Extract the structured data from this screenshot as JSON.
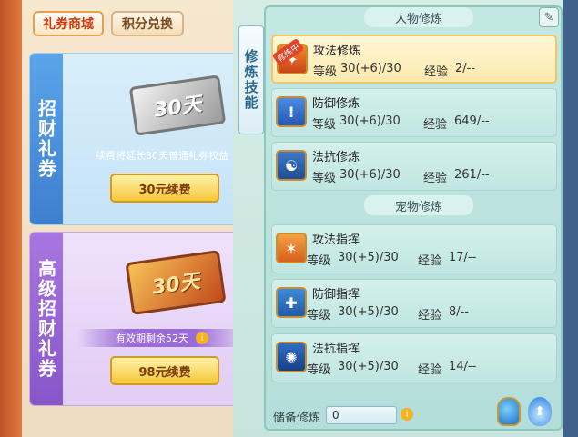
{
  "tabs": [
    {
      "label": "礼券商城",
      "active": true
    },
    {
      "label": "积分兑换",
      "active": false
    }
  ],
  "coupon_cards": [
    {
      "side_title": "招财礼券",
      "ticket_text": "30天",
      "note": "续费将延长30天普通礼券权益",
      "button": "30元续费"
    },
    {
      "side_title": "高级招财礼券",
      "ticket_text": "30天",
      "note": "有效期剩余52天",
      "button": "98元续费"
    }
  ],
  "vertical_tab": "修炼技能",
  "sections": {
    "character": "人物修炼",
    "pet": "宠物修炼"
  },
  "character_skills": [
    {
      "name": "攻法修炼",
      "level": "30(+6)/30",
      "exp": "2/--",
      "badge": "修炼中",
      "selected": true,
      "icon": "magic-attack-icon"
    },
    {
      "name": "防御修炼",
      "level": "30(+6)/30",
      "exp": "649/--",
      "selected": false,
      "icon": "defense-icon"
    },
    {
      "name": "法抗修炼",
      "level": "30(+6)/30",
      "exp": "261/--",
      "selected": false,
      "icon": "resist-icon"
    }
  ],
  "pet_skills": [
    {
      "name": "攻法指挥",
      "level": "30(+5)/30",
      "exp": "17/--",
      "icon": "pet-attack-icon"
    },
    {
      "name": "防御指挥",
      "level": "30(+5)/30",
      "exp": "8/--",
      "icon": "pet-defense-icon"
    },
    {
      "name": "法抗指挥",
      "level": "30(+5)/30",
      "exp": "14/--",
      "icon": "pet-resist-icon"
    }
  ],
  "labels": {
    "level": "等级",
    "exp": "经验"
  },
  "reserve": {
    "label": "储备修炼",
    "value": "0"
  },
  "colors": {
    "accent": "#e2a24f",
    "panel": "#c3e8e3",
    "selected_row": "#fbe9ad"
  }
}
